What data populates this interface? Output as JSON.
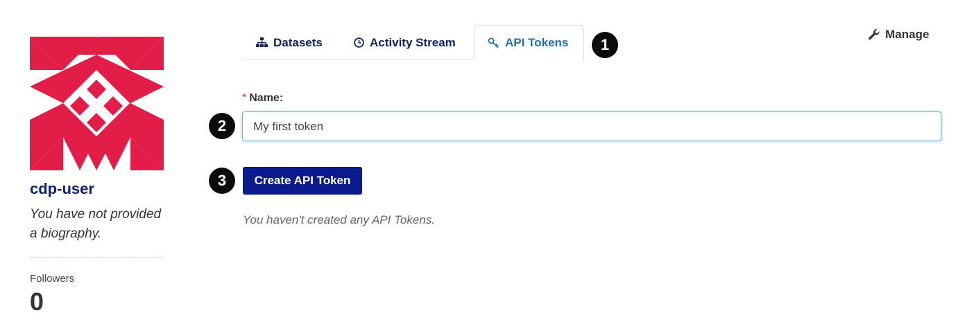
{
  "profile": {
    "username": "cdp-user",
    "bio": "You have not provided a biography.",
    "followers_label": "Followers",
    "followers_count": "0",
    "avatar_color": "#e11d48"
  },
  "tabs": [
    {
      "label": "Datasets",
      "icon": "sitemap-icon",
      "active": false
    },
    {
      "label": "Activity Stream",
      "icon": "clock-icon",
      "active": false
    },
    {
      "label": "API Tokens",
      "icon": "key-icon",
      "active": true
    }
  ],
  "manage": {
    "label": "Manage",
    "icon": "wrench-icon"
  },
  "steps": [
    "1",
    "2",
    "3"
  ],
  "form": {
    "required_marker": "*",
    "name_label": "Name:",
    "name_value": "My first token",
    "submit_label": "Create API Token"
  },
  "empty_message": "You haven't created any API Tokens.",
  "colors": {
    "nav_text": "#0f1f6b",
    "active_tab": "#1f6fb5",
    "primary_button": "#0b1a8c",
    "step_badge": "#0b0b0b"
  }
}
